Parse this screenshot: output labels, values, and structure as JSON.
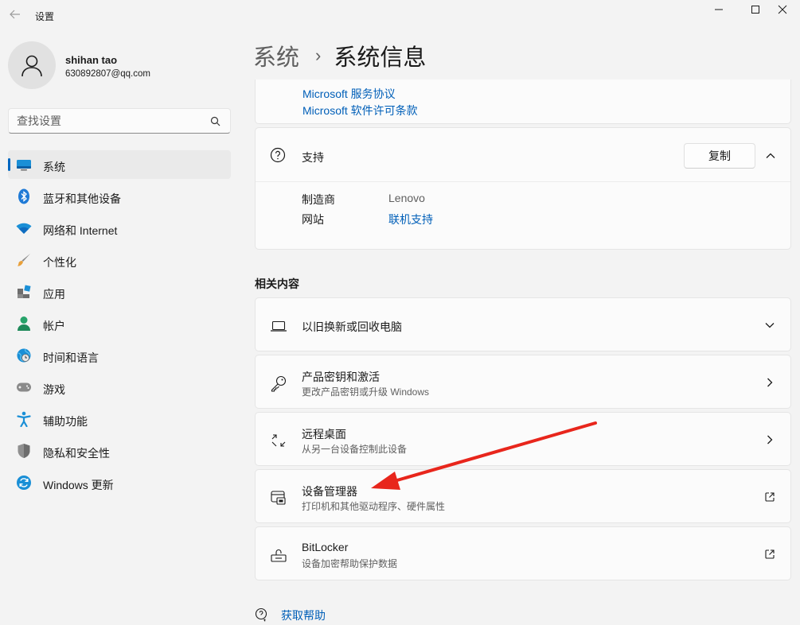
{
  "window": {
    "title": "设置",
    "back_icon": "arrow-left-icon",
    "minimize_icon": "minimize-icon",
    "maximize_icon": "maximize-icon",
    "close_icon": "close-icon"
  },
  "profile": {
    "name": "shihan tao",
    "email": "630892807@qq.com",
    "avatar_icon": "person-icon"
  },
  "search": {
    "placeholder": "查找设置",
    "icon": "search-icon"
  },
  "sidebar": {
    "items": [
      {
        "label": "系统",
        "icon": "system-monitor-icon",
        "active": true
      },
      {
        "label": "蓝牙和其他设备",
        "icon": "bluetooth-icon"
      },
      {
        "label": "网络和 Internet",
        "icon": "wifi-icon"
      },
      {
        "label": "个性化",
        "icon": "paintbrush-icon"
      },
      {
        "label": "应用",
        "icon": "apps-icon"
      },
      {
        "label": "帐户",
        "icon": "account-icon"
      },
      {
        "label": "时间和语言",
        "icon": "globe-clock-icon"
      },
      {
        "label": "游戏",
        "icon": "gamepad-icon"
      },
      {
        "label": "辅助功能",
        "icon": "accessibility-icon"
      },
      {
        "label": "隐私和安全性",
        "icon": "shield-icon"
      },
      {
        "label": "Windows 更新",
        "icon": "update-icon"
      }
    ]
  },
  "breadcrumb": {
    "parent": "系统",
    "separator": "›",
    "current": "系统信息"
  },
  "legal": {
    "link1": "Microsoft 服务协议",
    "link2": "Microsoft 软件许可条款"
  },
  "support": {
    "title": "支持",
    "icon": "question-circle-icon",
    "copy_label": "复制",
    "manufacturer_label": "制造商",
    "manufacturer_value": "Lenovo",
    "website_label": "网站",
    "website_value": "联机支持"
  },
  "related": {
    "title": "相关内容",
    "items": [
      {
        "title": "以旧换新或回收电脑",
        "subtitle": "",
        "icon": "laptop-icon",
        "action": "chevron-down-icon"
      },
      {
        "title": "产品密钥和激活",
        "subtitle": "更改产品密钥或升级 Windows",
        "icon": "key-icon",
        "action": "chevron-right-icon"
      },
      {
        "title": "远程桌面",
        "subtitle": "从另一台设备控制此设备",
        "icon": "remote-desktop-icon",
        "action": "chevron-right-icon"
      },
      {
        "title": "设备管理器",
        "subtitle": "打印机和其他驱动程序、硬件属性",
        "icon": "device-manager-icon",
        "action": "external-link-icon"
      },
      {
        "title": "BitLocker",
        "subtitle": "设备加密帮助保护数据",
        "icon": "bitlocker-lock-icon",
        "action": "external-link-icon"
      }
    ]
  },
  "help": {
    "label": "获取帮助",
    "icon": "help-chat-icon"
  },
  "colors": {
    "accent": "#0067c0",
    "link": "#005fb8",
    "annotation_arrow": "#e8261c"
  }
}
